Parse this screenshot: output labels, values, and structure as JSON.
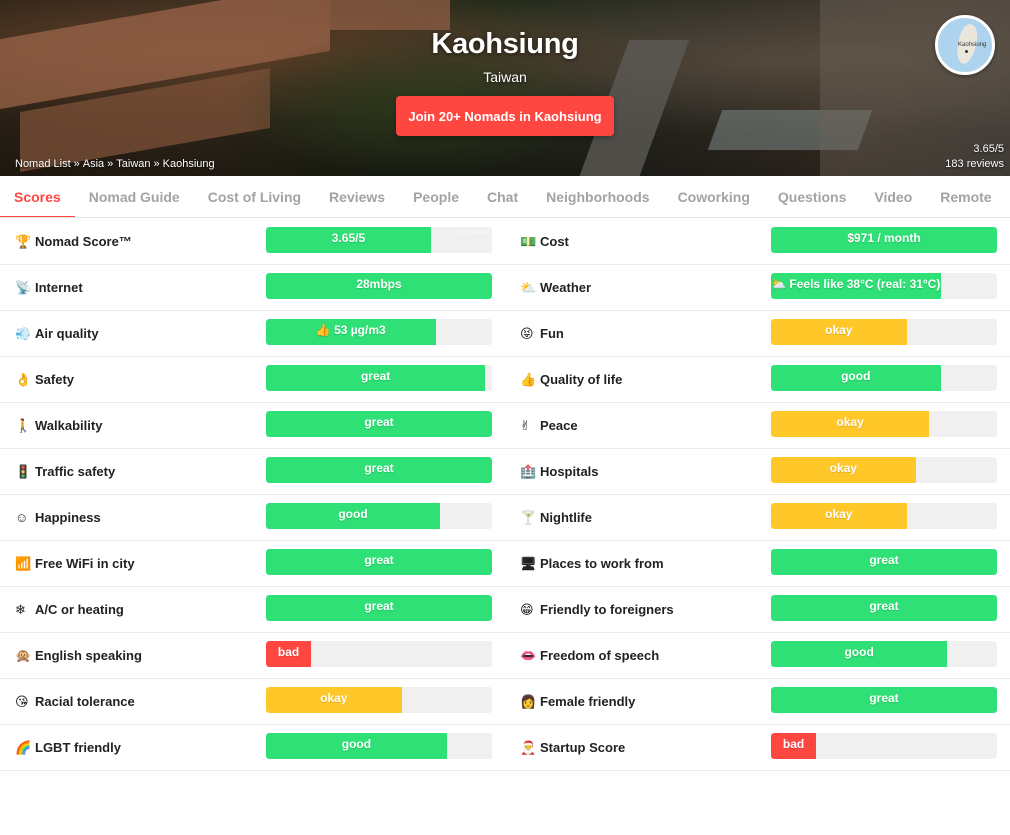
{
  "hero": {
    "title": "Kaohsiung",
    "country": "Taiwan",
    "join_label": "Join 20+ Nomads in Kaohsiung",
    "breadcrumb": [
      "Nomad List",
      "Asia",
      "Taiwan",
      "Kaohsiung"
    ],
    "breadcrumb_sep": "»",
    "score": "3.65/5",
    "reviews": "183 reviews",
    "map_label": "Kaohsiung"
  },
  "tabs": [
    "Scores",
    "Nomad Guide",
    "Cost of Living",
    "Reviews",
    "People",
    "Chat",
    "Neighborhoods",
    "Coworking",
    "Questions",
    "Video",
    "Remote"
  ],
  "active_tab": "Scores",
  "colors": {
    "accent": "#ff4742",
    "good": "#2ee075",
    "okay": "#ffc828",
    "bad": "#ff4742",
    "bar_bg": "#f0f0f0"
  },
  "scores": [
    {
      "left": {
        "icon": "🏆",
        "icon_name": "trophy-icon",
        "label": "Nomad Score™",
        "value": "3.65/5",
        "level": 0.73,
        "color": "good",
        "tag": "183 reviews"
      },
      "right": {
        "icon": "💵",
        "icon_name": "money-icon",
        "label": "Cost",
        "value": "$971 / month",
        "level": 1.0,
        "color": "good"
      }
    },
    {
      "left": {
        "icon": "📡",
        "icon_name": "satellite-icon",
        "label": "Internet",
        "value": "28mbps",
        "level": 1.0,
        "color": "good"
      },
      "right": {
        "icon": "⛅",
        "icon_name": "weather-icon",
        "label": "Weather",
        "value": "⛅ Feels like 38°C (real: 31°C)",
        "level": 0.75,
        "color": "good"
      }
    },
    {
      "left": {
        "icon": "💨",
        "icon_name": "air-icon",
        "label": "Air quality",
        "value": "👍 53 µg/m3",
        "level": 0.75,
        "color": "good"
      },
      "right": {
        "icon": "😝",
        "icon_name": "fun-icon",
        "label": "Fun",
        "value": "okay",
        "level": 0.6,
        "color": "okay"
      }
    },
    {
      "left": {
        "icon": "👌",
        "icon_name": "ok-hand-icon",
        "label": "Safety",
        "value": "great",
        "level": 0.97,
        "color": "good"
      },
      "right": {
        "icon": "👍",
        "icon_name": "thumbs-up-icon",
        "label": "Quality of life",
        "value": "good",
        "level": 0.75,
        "color": "good"
      }
    },
    {
      "left": {
        "icon": "🚶",
        "icon_name": "walking-icon",
        "label": "Walkability",
        "value": "great",
        "level": 1.0,
        "color": "good"
      },
      "right": {
        "icon": "✌",
        "icon_name": "peace-icon",
        "label": "Peace",
        "value": "okay",
        "level": 0.7,
        "color": "okay"
      }
    },
    {
      "left": {
        "icon": "🚦",
        "icon_name": "traffic-light-icon",
        "label": "Traffic safety",
        "value": "great",
        "level": 1.0,
        "color": "good"
      },
      "right": {
        "icon": "🏥",
        "icon_name": "hospital-icon",
        "label": "Hospitals",
        "value": "okay",
        "level": 0.64,
        "color": "okay"
      }
    },
    {
      "left": {
        "icon": "☺",
        "icon_name": "smile-icon",
        "label": "Happiness",
        "value": "good",
        "level": 0.77,
        "color": "good"
      },
      "right": {
        "icon": "🍸",
        "icon_name": "cocktail-icon",
        "label": "Nightlife",
        "value": "okay",
        "level": 0.6,
        "color": "okay"
      }
    },
    {
      "left": {
        "icon": "📶",
        "icon_name": "wifi-icon",
        "label": "Free WiFi in city",
        "value": "great",
        "level": 1.0,
        "color": "good"
      },
      "right": {
        "icon": "🖥",
        "icon_name": "desktop-icon",
        "label": "Places to work from",
        "value": "great",
        "level": 1.0,
        "color": "good"
      }
    },
    {
      "left": {
        "icon": "❄",
        "icon_name": "snowflake-icon",
        "label": "A/C or heating",
        "value": "great",
        "level": 1.0,
        "color": "good"
      },
      "right": {
        "icon": "😁",
        "icon_name": "grin-icon",
        "label": "Friendly to foreigners",
        "value": "great",
        "level": 1.0,
        "color": "good"
      }
    },
    {
      "left": {
        "icon": "🙊",
        "icon_name": "speak-no-evil-icon",
        "label": "English speaking",
        "value": "bad",
        "level": 0.2,
        "color": "bad"
      },
      "right": {
        "icon": "👄",
        "icon_name": "speech-icon",
        "label": "Freedom of speech",
        "value": "good",
        "level": 0.78,
        "color": "good"
      }
    },
    {
      "left": {
        "icon": "😘",
        "icon_name": "kiss-icon",
        "label": "Racial tolerance",
        "value": "okay",
        "level": 0.6,
        "color": "okay"
      },
      "right": {
        "icon": "👩",
        "icon_name": "woman-icon",
        "label": "Female friendly",
        "value": "great",
        "level": 1.0,
        "color": "good"
      }
    },
    {
      "left": {
        "icon": "🌈",
        "icon_name": "rainbow-icon",
        "label": "LGBT friendly",
        "value": "good",
        "level": 0.8,
        "color": "good"
      },
      "right": {
        "icon": "🎅",
        "icon_name": "startup-icon",
        "label": "Startup Score",
        "value": "bad",
        "level": 0.2,
        "color": "bad"
      }
    }
  ]
}
